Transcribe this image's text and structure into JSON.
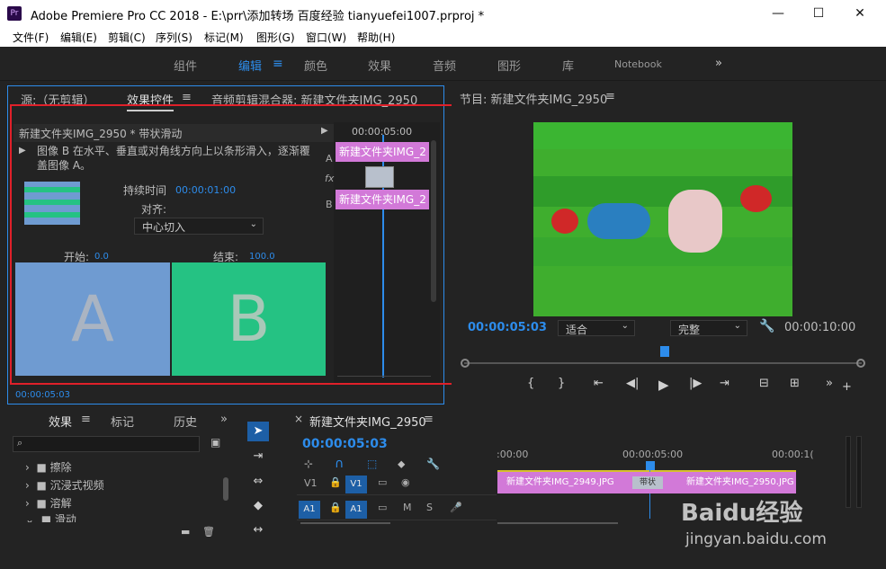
{
  "window": {
    "title": "Adobe Premiere Pro CC 2018 - E:\\prr\\添加转场 百度经验 tianyuefei1007.prproj *",
    "icon": "Pr",
    "min": "—",
    "max": "☐",
    "close": "✕"
  },
  "menu": [
    "文件(F)",
    "编辑(E)",
    "剪辑(C)",
    "序列(S)",
    "标记(M)",
    "图形(G)",
    "窗口(W)",
    "帮助(H)"
  ],
  "workspaces": [
    "组件",
    "编辑",
    "颜色",
    "效果",
    "音频",
    "图形",
    "库",
    "Notebook"
  ],
  "source_panel": {
    "tabs": [
      "源:（无剪辑）",
      "效果控件",
      "音频剪辑混合器: 新建文件夹IMG_2950"
    ],
    "clip_header": "新建文件夹IMG_2950 * 带状滑动",
    "description": "图像 B 在水平、垂直或对角线方向上以条形滑入，逐渐覆盖图像 A。",
    "duration_label": "持续时间",
    "duration_value": "00:00:01:00",
    "align_label": "对齐:",
    "align_value": "中心切入",
    "start_label": "开始:",
    "start_value": "0.0",
    "end_label": "结束:",
    "end_value": "100.0",
    "preview_a": "A",
    "preview_b": "B",
    "mini_time": "00:00:05:00",
    "clip_a": "新建文件夹IMG_2",
    "clip_b": "新建文件夹IMG_2",
    "label_a": "A",
    "label_b": "B",
    "fx": "fx",
    "timecode": "00:00:05:03"
  },
  "program_panel": {
    "title": "节目: 新建文件夹IMG_2950",
    "timecode": "00:00:05:03",
    "fit": "适合",
    "quality": "完整",
    "duration": "00:00:10:00"
  },
  "effects_panel": {
    "tabs": [
      "效果",
      "标记",
      "历史"
    ],
    "items": [
      "擦除",
      "沉浸式视频",
      "溶解",
      "滑动"
    ]
  },
  "timeline": {
    "title": "新建文件夹IMG_2950",
    "timecode": "00:00:05:03",
    "ruler": [
      ":00:00",
      "00:00:05:00",
      "00:00:1("
    ],
    "v1": "V1",
    "a1": "A1",
    "clip1": "新建文件夹IMG_2949.JPG",
    "clip2": "新建文件夹IMG_2950.JPG",
    "transition": "带状"
  },
  "watermark": {
    "brand": "Baidu经验",
    "url": "jingyan.baidu.com"
  },
  "colors": {
    "accent": "#2d8ceb",
    "clip": "#d279d8",
    "red_box": "#e0202a",
    "preview_a": "#6f9bd1",
    "preview_b": "#25c283"
  }
}
